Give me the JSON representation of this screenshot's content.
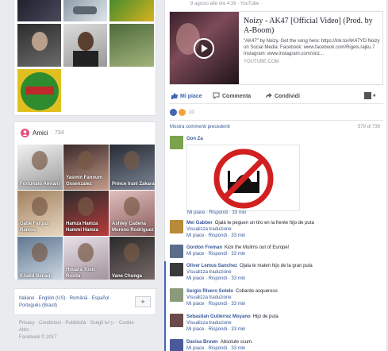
{
  "left_top": {},
  "friends": {
    "title": "Amici",
    "count": "· 734",
    "items": [
      {
        "name": "Fortunato Amrani"
      },
      {
        "name": "Yasmin Fanoum Ossenzalez"
      },
      {
        "name": "Prince Iranl Zakara"
      },
      {
        "name": "Gabe Fargas Ramos"
      },
      {
        "name": "Hamza Hamza Hammi Hamza"
      },
      {
        "name": "Ashley Cadena Moreno Rodriguez"
      },
      {
        "name": "Khalid Benadi"
      },
      {
        "name": "Houara Tosic Rosita"
      },
      {
        "name": "Vane Chunga"
      }
    ]
  },
  "languages": {
    "line1": "Italiano · English (US) · Română · Español ·",
    "line2": "Português (Brasil)",
    "add": "+"
  },
  "footer": {
    "line1": "Privacy · Condizioni · Pubblicità · Scegli tu! ▷ · Cookie ·",
    "line2": "Altro ·",
    "line3": "Facebook © 2017"
  },
  "post": {
    "meta": "9 agosto alle ore 4:36 · YouTube ·",
    "link_title": "Noizy - AK47 [Official Video] (Prod. by A-Boom)",
    "link_desc": "\"AK47\" by Noizy. Get the song here: https://lnk.to/AK47YD Noizy on Social Media: Facebook: www.facebook.com/Rigels.rajku.7 Instagram: www.instagram.com/sinz...",
    "link_domain": "YOUTUBE.COM",
    "like_label": "Mi piace",
    "comment_label": "Commenta",
    "share_label": "Condividi",
    "reaction_count": "10",
    "prev_comments": "Mostra commenti precedenti",
    "comment_counter": "579 di 739"
  },
  "comments": [
    {
      "name": "Gon Za",
      "text": "",
      "sub": "",
      "meta": "Mi piace · Rispondi · 33 min"
    },
    {
      "name": "Mei Gabber",
      "text": "Ojalá te peguen un tiro en la frente hijo de puta",
      "sub": "Visualizza traduzione",
      "meta": "Mi piace · Rispondi · 33 min"
    },
    {
      "name": "Gordon Freman",
      "text": "Kick the Mulims out of Europe!",
      "sub": "",
      "meta": "Mi piace · Rispondi · 33 min"
    },
    {
      "name": "Oliver Lemus Sanchez",
      "text": "Ojala te maten hijo de la gran puta",
      "sub": "Visualizza traduzione",
      "meta": "Mi piace · Rispondi · 33 min"
    },
    {
      "name": "Sergio Rivero Sotelo",
      "text": "Cobarde asqueroso",
      "sub": "Visualizza traduzione",
      "meta": "Mi piace · Rispondi · 33 min"
    },
    {
      "name": "Sebastián Gutiérrez Moyano",
      "text": "Hijo de puta",
      "sub": "Visualizza traduzione",
      "meta": "Mi piace · Rispondi · 33 min"
    },
    {
      "name": "Davisa Brown",
      "text": "Absolute scum.",
      "sub": "",
      "meta": "Mi piace · Rispondi · 33 min"
    }
  ],
  "colors": {
    "fb_blue": "#365899",
    "brand": "#4267b2",
    "no_sign": "#d21f1f"
  },
  "icons": [
    "friends-icon",
    "play-icon",
    "like-icon",
    "comment-icon",
    "share-icon",
    "no-mosque-sign-icon"
  ]
}
